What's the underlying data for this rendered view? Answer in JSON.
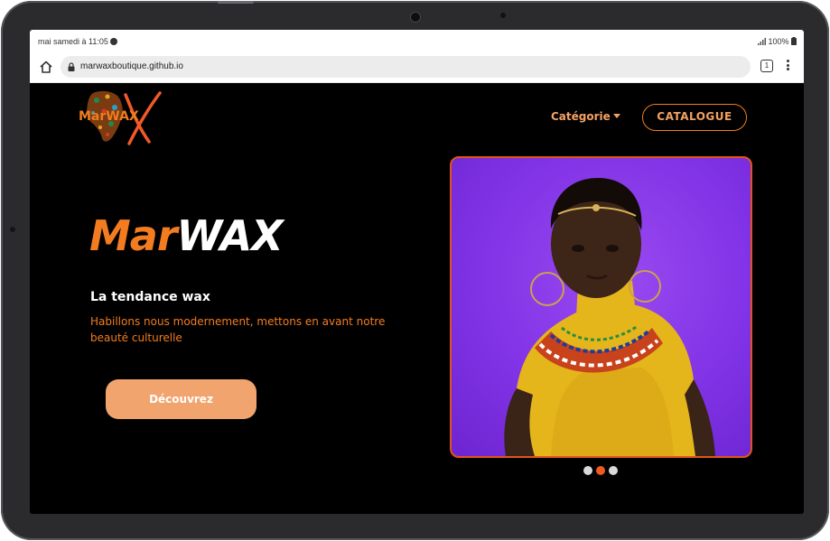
{
  "status_bar": {
    "time": "mai samedi à 11:05",
    "battery": "100%"
  },
  "browser": {
    "url": "marwaxboutique.github.io",
    "tab_count": "1"
  },
  "site": {
    "logo_text": "MarWAX",
    "nav": {
      "categorie_label": "Catégorie",
      "catalogue_label": "CATALOGUE"
    },
    "hero": {
      "title_part1": "Mar",
      "title_part2": "WAX",
      "subtitle": "La tendance wax",
      "description": "Habillons nous modernement, mettons en avant notre beauté culturelle",
      "cta_label": "Découvrez"
    },
    "carousel": {
      "slide_count": 3,
      "active_index": 1
    }
  },
  "colors": {
    "brand_orange": "#f47c20",
    "cta_peach": "#f2a46e",
    "image_background": "#8133e6",
    "dot_active": "#ef5b1f",
    "dot_inactive": "#d9d9d9"
  }
}
